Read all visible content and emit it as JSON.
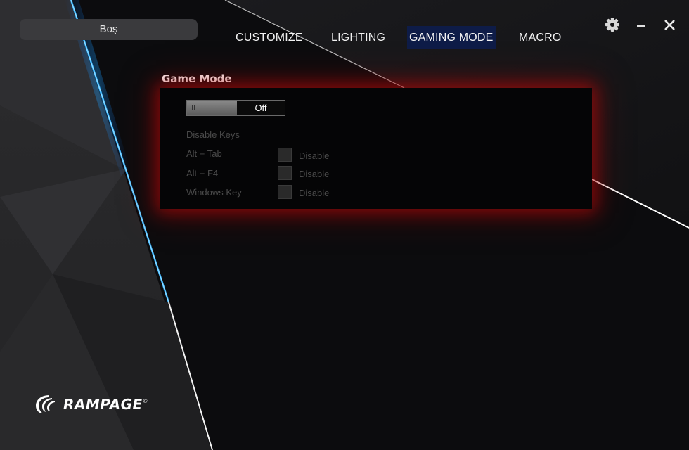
{
  "profile": {
    "name": "Boş"
  },
  "nav": {
    "tabs": [
      {
        "label": "CUSTOMIZE",
        "active": false
      },
      {
        "label": "LIGHTING",
        "active": false
      },
      {
        "label": "GAMING MODE",
        "active": true
      },
      {
        "label": "MACRO",
        "active": false
      }
    ]
  },
  "window_controls": {
    "settings_icon": "gear-icon",
    "minimize_icon": "minimize-icon",
    "close_icon": "close-icon"
  },
  "game_mode": {
    "title": "Game Mode",
    "toggle": {
      "state_label": "Off",
      "enabled": false
    },
    "disable_keys_heading": "Disable Keys",
    "keys": [
      {
        "label": "Alt + Tab",
        "option_label": "Disable",
        "checked": false
      },
      {
        "label": "Alt + F4",
        "option_label": "Disable",
        "checked": false
      },
      {
        "label": "Windows Key",
        "option_label": "Disable",
        "checked": false
      }
    ]
  },
  "brand": {
    "logo_text": "RAMPAGE",
    "registered": "®"
  },
  "colors": {
    "active_tab_bg": "#0e1c48",
    "panel_glow": "#c80a0a",
    "accent_line": "#2aa8ff"
  }
}
